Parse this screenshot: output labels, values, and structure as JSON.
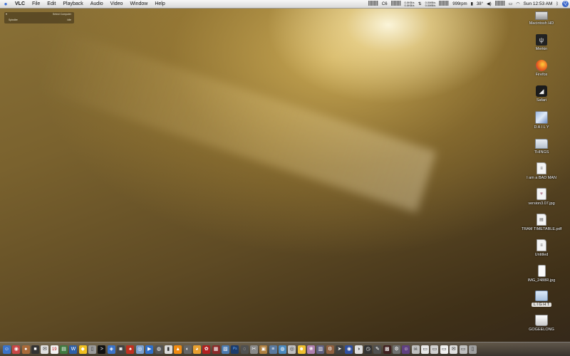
{
  "menubar": {
    "apple": "",
    "items": [
      "VLC",
      "File",
      "Edit",
      "Playback",
      "Audio",
      "Video",
      "Window",
      "Help"
    ],
    "status": {
      "cpu_label": "C6",
      "net_top": "0.0KB/s",
      "net_bottom": "0.0KB/s",
      "disk_top": "0.0MB/s",
      "disk_bottom": "0.0MB/s",
      "fan": "999rpm",
      "temp": "38°",
      "clock": "Sun 12:53 AM",
      "bluetooth": "ᛒ",
      "spotlight": "Q"
    }
  },
  "widget": {
    "title": "Select Computer",
    "left": "Spindler",
    "right": "Idle"
  },
  "desktop": {
    "icons": [
      {
        "label": "Macintosh HD",
        "icon": "hard-drive-icon"
      },
      {
        "label": "Merkin",
        "icon": "usb-drive-icon"
      },
      {
        "label": "Firefox",
        "icon": "firefox-icon"
      },
      {
        "label": "Safari",
        "icon": "safari-icon"
      },
      {
        "label": "D A I L Y",
        "icon": "image-folder-icon"
      },
      {
        "label": "THINGS",
        "icon": "folder-icon"
      },
      {
        "label": "I am a BAD MAN",
        "icon": "document-icon"
      },
      {
        "label": "version3.07.jpg",
        "icon": "image-file-icon"
      },
      {
        "label": "TRAM TIMETABLE.pdf",
        "icon": "pdf-file-icon"
      },
      {
        "label": "Untitled",
        "icon": "document-icon"
      },
      {
        "label": "IMG_2488R.jpg",
        "icon": "image-file-icon"
      },
      {
        "label": "L I G H T",
        "icon": "folder-icon"
      },
      {
        "label": "GOGEELONG",
        "icon": "external-drive-icon"
      }
    ]
  },
  "dock": {
    "calendar_date": "19",
    "items": [
      {
        "name": "finder-icon",
        "color": "#3b73c8",
        "glyph": "☺"
      },
      {
        "name": "dashboard-icon",
        "color": "#c84646",
        "glyph": "◉"
      },
      {
        "name": "sphere-app-icon",
        "color": "#a96a3a",
        "glyph": "●"
      },
      {
        "name": "dark-app-icon",
        "color": "#333333",
        "glyph": "■"
      },
      {
        "name": "mail-icon",
        "color": "#e0e0e0",
        "glyph": "✉"
      },
      {
        "name": "ical-icon",
        "color": "#f2f2f2",
        "glyph": "19"
      },
      {
        "name": "utility-icon",
        "color": "#3f7a3f",
        "glyph": "▤"
      },
      {
        "name": "word-icon",
        "color": "#2d5fa8",
        "glyph": "W"
      },
      {
        "name": "adium-icon",
        "color": "#f0c020",
        "glyph": "◆"
      },
      {
        "name": "trash-small-icon",
        "color": "#9a9a9a",
        "glyph": "▯"
      },
      {
        "name": "terminal-icon",
        "color": "#111111",
        "glyph": ">"
      },
      {
        "name": "network-icon",
        "color": "#3b73c8",
        "glyph": "◈"
      },
      {
        "name": "camera-icon",
        "color": "#444444",
        "glyph": "◙"
      },
      {
        "name": "red-app-icon",
        "color": "#c03020",
        "glyph": "♠"
      },
      {
        "name": "safari-dock-icon",
        "color": "#7aa0d0",
        "glyph": "◎"
      },
      {
        "name": "quicktime-icon",
        "color": "#2f6fc9",
        "glyph": "▶"
      },
      {
        "name": "radio-icon",
        "color": "#555555",
        "glyph": "◍"
      },
      {
        "name": "remote-icon",
        "color": "#dddddd",
        "glyph": "▮"
      },
      {
        "name": "vlc-icon",
        "color": "#f08a10",
        "glyph": "▲"
      },
      {
        "name": "mouse-icon",
        "color": "#666666",
        "glyph": "◐"
      },
      {
        "name": "duck-icon",
        "color": "#e8a030",
        "glyph": "◕"
      },
      {
        "name": "ladybug-icon",
        "color": "#b02020",
        "glyph": "✿"
      },
      {
        "name": "grid-app-icon",
        "color": "#8a2a2a",
        "glyph": "▦"
      },
      {
        "name": "preview-icon",
        "color": "#4a7ab0",
        "glyph": "▧"
      },
      {
        "name": "photoshop-icon",
        "color": "#1c3c6c",
        "glyph": "Ps"
      },
      {
        "name": "disc-icon",
        "color": "#505050",
        "glyph": "◌"
      },
      {
        "name": "tools-icon",
        "color": "#8a8a8a",
        "glyph": "✂"
      },
      {
        "name": "box-icon",
        "color": "#b08040",
        "glyph": "▣"
      },
      {
        "name": "stack-icon",
        "color": "#5a7aa0",
        "glyph": "≡"
      },
      {
        "name": "globe-icon",
        "color": "#4a8ac0",
        "glyph": "◍"
      },
      {
        "name": "cd-icon",
        "color": "#c0c0c0",
        "glyph": "◎"
      },
      {
        "name": "smiley-icon",
        "color": "#f0c030",
        "glyph": "☻"
      },
      {
        "name": "brain-icon",
        "color": "#b080b0",
        "glyph": "❀"
      },
      {
        "name": "chart-app-icon",
        "color": "#606080",
        "glyph": "▥"
      },
      {
        "name": "gear-icon",
        "color": "#906040",
        "glyph": "⚙"
      },
      {
        "name": "rocket-icon",
        "color": "#404040",
        "glyph": "➤"
      },
      {
        "name": "eye-icon",
        "color": "#3050a0",
        "glyph": "◉"
      },
      {
        "name": "panda-icon",
        "color": "#e0e0e0",
        "glyph": "◑"
      },
      {
        "name": "clock-icon",
        "color": "#333333",
        "glyph": "◷"
      },
      {
        "name": "pen-icon",
        "color": "#505050",
        "glyph": "✎"
      },
      {
        "name": "film-icon",
        "color": "#402020",
        "glyph": "▩"
      },
      {
        "name": "settings-icon",
        "color": "#707070",
        "glyph": "⚙"
      },
      {
        "name": "people-icon",
        "color": "#604080",
        "glyph": "☺"
      },
      {
        "name": "skull-icon",
        "color": "#c0c0c0",
        "glyph": "☠"
      },
      {
        "name": "window-thumb-1-icon",
        "color": "#e8e8e8",
        "glyph": "▭"
      },
      {
        "name": "window-thumb-2-icon",
        "color": "#d0d0d0",
        "glyph": "▭"
      },
      {
        "name": "window-thumb-3-icon",
        "color": "#f0f0f0",
        "glyph": "▭"
      },
      {
        "name": "mail-envelope-icon",
        "color": "#e0e0e0",
        "glyph": "✉"
      },
      {
        "name": "window-thumb-4-icon",
        "color": "#c0c0c0",
        "glyph": "▭"
      },
      {
        "name": "trash-icon",
        "color": "#a0a0a0",
        "glyph": "▯"
      }
    ]
  }
}
